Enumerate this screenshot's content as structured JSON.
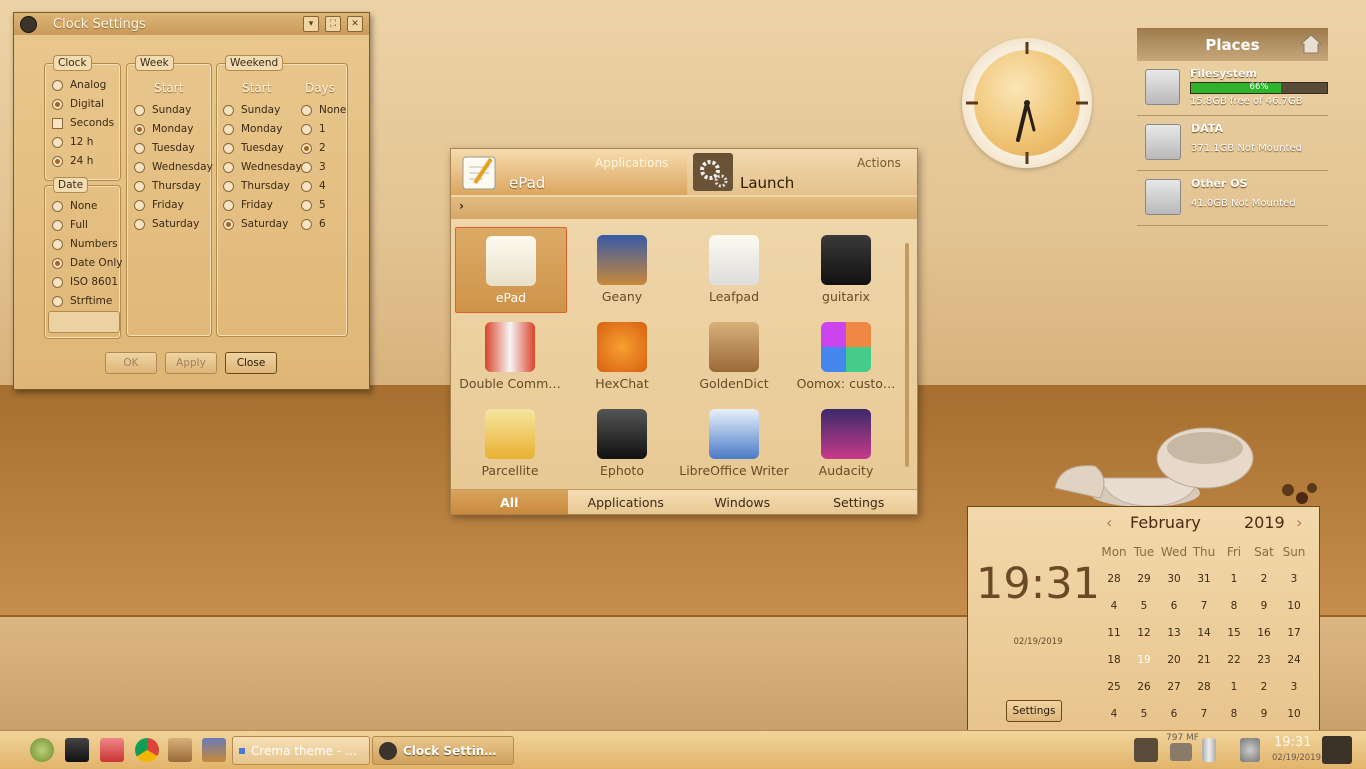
{
  "clock_settings": {
    "title": "Clock Settings",
    "clock": {
      "label": "Clock",
      "options": [
        {
          "label": "Analog",
          "type": "radio",
          "checked": false
        },
        {
          "label": "Digital",
          "type": "radio",
          "checked": true
        },
        {
          "label": "Seconds",
          "type": "check",
          "checked": false
        },
        {
          "label": "12 h",
          "type": "radio",
          "checked": false
        },
        {
          "label": "24 h",
          "type": "radio",
          "checked": true
        }
      ]
    },
    "date": {
      "label": "Date",
      "options": [
        {
          "label": "None",
          "checked": false
        },
        {
          "label": "Full",
          "checked": false
        },
        {
          "label": "Numbers",
          "checked": false
        },
        {
          "label": "Date Only",
          "checked": true
        },
        {
          "label": "ISO 8601",
          "checked": false
        },
        {
          "label": "Strftime",
          "checked": false
        }
      ]
    },
    "week": {
      "label": "Week",
      "heading": "Start",
      "options": [
        {
          "label": "Sunday",
          "checked": false
        },
        {
          "label": "Monday",
          "checked": true
        },
        {
          "label": "Tuesday",
          "checked": false
        },
        {
          "label": "Wednesday",
          "checked": false
        },
        {
          "label": "Thursday",
          "checked": false
        },
        {
          "label": "Friday",
          "checked": false
        },
        {
          "label": "Saturday",
          "checked": false
        }
      ]
    },
    "weekend": {
      "label": "Weekend",
      "start_heading": "Start",
      "days_heading": "Days",
      "start": [
        {
          "label": "Sunday",
          "checked": false
        },
        {
          "label": "Monday",
          "checked": false
        },
        {
          "label": "Tuesday",
          "checked": false
        },
        {
          "label": "Wednesday",
          "checked": false
        },
        {
          "label": "Thursday",
          "checked": false
        },
        {
          "label": "Friday",
          "checked": false
        },
        {
          "label": "Saturday",
          "checked": true
        }
      ],
      "days": [
        {
          "label": "None",
          "checked": false
        },
        {
          "label": "1",
          "checked": false
        },
        {
          "label": "2",
          "checked": true
        },
        {
          "label": "3",
          "checked": false
        },
        {
          "label": "4",
          "checked": false
        },
        {
          "label": "5",
          "checked": false
        },
        {
          "label": "6",
          "checked": false
        }
      ]
    },
    "buttons": {
      "ok": "OK",
      "apply": "Apply",
      "close": "Close"
    }
  },
  "places": {
    "title": "Places",
    "items": [
      {
        "name": "Filesystem",
        "info": "15.8GB free of 46.7GB",
        "usage_percent": 66,
        "usage_label": "66%"
      },
      {
        "name": "DATA",
        "info": "371.1GB Not Mounted"
      },
      {
        "name": "Other OS",
        "info": "41.0GB Not Mounted"
      }
    ]
  },
  "launcher": {
    "left_sub": "Applications",
    "left_main": "ePad",
    "right_sub": "Actions",
    "right_main": "Launch",
    "crumb": "›",
    "apps": [
      {
        "label": "ePad",
        "icon": "epad-icon",
        "selected": true
      },
      {
        "label": "Geany",
        "icon": "geany-icon"
      },
      {
        "label": "Leafpad",
        "icon": "leafpad-icon"
      },
      {
        "label": "guitarix",
        "icon": "guitarix-icon"
      },
      {
        "label": "Double Comm…",
        "icon": "doublecmd-icon"
      },
      {
        "label": "HexChat",
        "icon": "hexchat-icon"
      },
      {
        "label": "GoldenDict",
        "icon": "goldendict-icon"
      },
      {
        "label": "Oomox: custo…",
        "icon": "oomox-icon"
      },
      {
        "label": "Parcellite",
        "icon": "parcellite-icon"
      },
      {
        "label": "Ephoto",
        "icon": "ephoto-icon"
      },
      {
        "label": "LibreOffice Writer",
        "icon": "writer-icon"
      },
      {
        "label": "Audacity",
        "icon": "audacity-icon"
      }
    ],
    "tabs": [
      "All",
      "Applications",
      "Windows",
      "Settings"
    ],
    "active_tab": "All"
  },
  "calendar": {
    "time": "19:31",
    "date": "02/19/2019",
    "month": "February",
    "year": "2019",
    "weekdays": [
      "Mon",
      "Tue",
      "Wed",
      "Thu",
      "Fri",
      "Sat",
      "Sun"
    ],
    "weeks": [
      [
        "28",
        "29",
        "30",
        "31",
        "1",
        "2",
        "3"
      ],
      [
        "4",
        "5",
        "6",
        "7",
        "8",
        "9",
        "10"
      ],
      [
        "11",
        "12",
        "13",
        "14",
        "15",
        "16",
        "17"
      ],
      [
        "18",
        "19",
        "20",
        "21",
        "22",
        "23",
        "24"
      ],
      [
        "25",
        "26",
        "27",
        "28",
        "1",
        "2",
        "3"
      ],
      [
        "4",
        "5",
        "6",
        "7",
        "8",
        "9",
        "10"
      ]
    ],
    "today": "19",
    "settings_label": "Settings"
  },
  "taskbar": {
    "tasks": [
      {
        "label": "Crema theme - …",
        "active": false
      },
      {
        "label": "Clock Settin…",
        "active": true
      }
    ],
    "memory": "797 MF",
    "time": "19:31",
    "date": "02/19/2019"
  }
}
